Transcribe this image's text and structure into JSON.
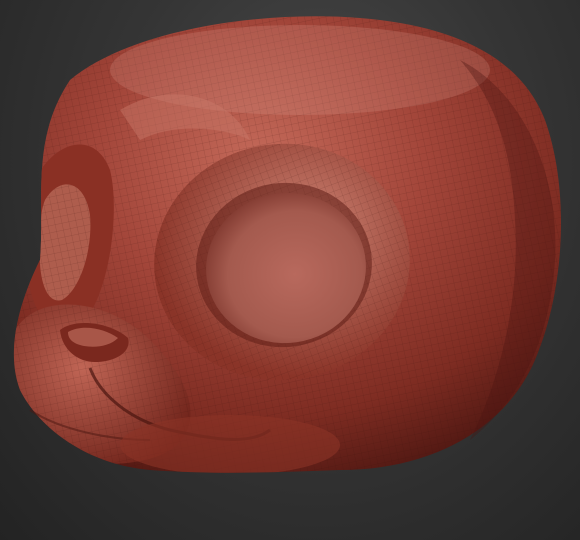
{
  "viewport": {
    "background_top": "#4a4a4a",
    "background_bottom": "#232323"
  },
  "model": {
    "kind": "sculpted-head-mesh",
    "material_color": "#9c3a2c",
    "highlight_color": "#d88878",
    "shadow_color": "#4a1510",
    "wireframe_visible": true
  }
}
